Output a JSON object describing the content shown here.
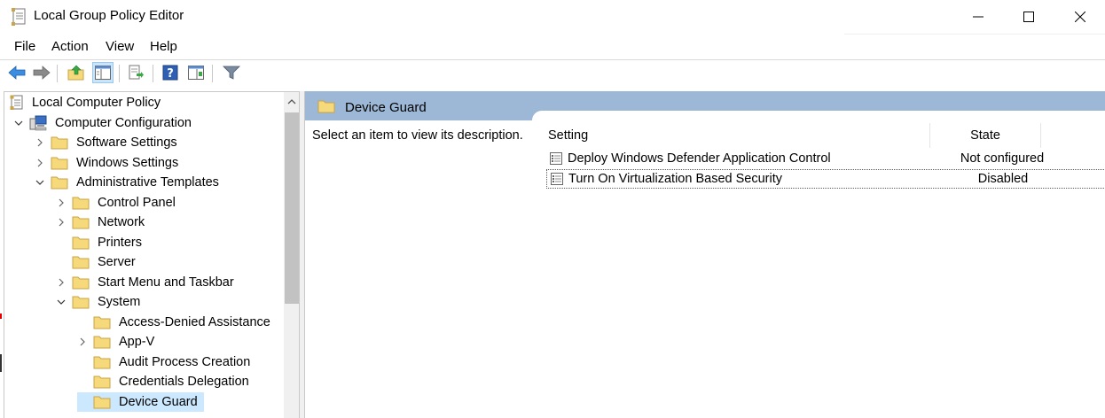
{
  "window": {
    "title": "Local Group Policy Editor",
    "minimize_icon": "minimize-icon",
    "maximize_icon": "maximize-icon",
    "close_icon": "close-icon"
  },
  "menu": {
    "items": [
      "File",
      "Action",
      "View",
      "Help"
    ]
  },
  "toolbar": {
    "buttons": [
      "back-arrow-icon",
      "forward-arrow-icon",
      "up-folder-icon",
      "show-hide-tree-icon",
      "export-list-icon",
      "help-icon",
      "extended-view-icon",
      "filter-icon"
    ],
    "active_button": "show-hide-tree-icon"
  },
  "tree": {
    "items": [
      {
        "label": "Local Computer Policy",
        "level": 0,
        "expander": "none",
        "icon": "policy-icon"
      },
      {
        "label": "Computer Configuration",
        "level": 1,
        "expander": "expanded",
        "icon": "computer-icon"
      },
      {
        "label": "Software Settings",
        "level": 2,
        "expander": "collapsed",
        "icon": "folder-icon"
      },
      {
        "label": "Windows Settings",
        "level": 2,
        "expander": "collapsed",
        "icon": "folder-icon"
      },
      {
        "label": "Administrative Templates",
        "level": 2,
        "expander": "expanded",
        "icon": "folder-icon"
      },
      {
        "label": "Control Panel",
        "level": 3,
        "expander": "collapsed",
        "icon": "folder-icon"
      },
      {
        "label": "Network",
        "level": 3,
        "expander": "collapsed",
        "icon": "folder-icon"
      },
      {
        "label": "Printers",
        "level": 3,
        "expander": "none",
        "icon": "folder-icon"
      },
      {
        "label": "Server",
        "level": 3,
        "expander": "none",
        "icon": "folder-icon"
      },
      {
        "label": "Start Menu and Taskbar",
        "level": 3,
        "expander": "collapsed",
        "icon": "folder-icon"
      },
      {
        "label": "System",
        "level": 3,
        "expander": "expanded",
        "icon": "folder-icon"
      },
      {
        "label": "Access-Denied Assistance",
        "level": 4,
        "expander": "none",
        "icon": "folder-icon"
      },
      {
        "label": "App-V",
        "level": 4,
        "expander": "collapsed",
        "icon": "folder-icon"
      },
      {
        "label": "Audit Process Creation",
        "level": 4,
        "expander": "none",
        "icon": "folder-icon"
      },
      {
        "label": "Credentials Delegation",
        "level": 4,
        "expander": "none",
        "icon": "folder-icon"
      },
      {
        "label": "Device Guard",
        "level": 4,
        "expander": "none",
        "icon": "folder-icon",
        "selected": true
      }
    ]
  },
  "details": {
    "header_title": "Device Guard",
    "description": "Select an item to view its description.",
    "columns": {
      "setting": "Setting",
      "state": "State"
    },
    "rows": [
      {
        "setting": "Deploy Windows Defender Application Control",
        "state": "Not configured"
      },
      {
        "setting": "Turn On Virtualization Based Security",
        "state": "Disabled",
        "focused": true
      }
    ]
  },
  "colors": {
    "header_band": "#9cb8d6",
    "selection": "#cce8ff",
    "folder": "#f5d97a"
  }
}
